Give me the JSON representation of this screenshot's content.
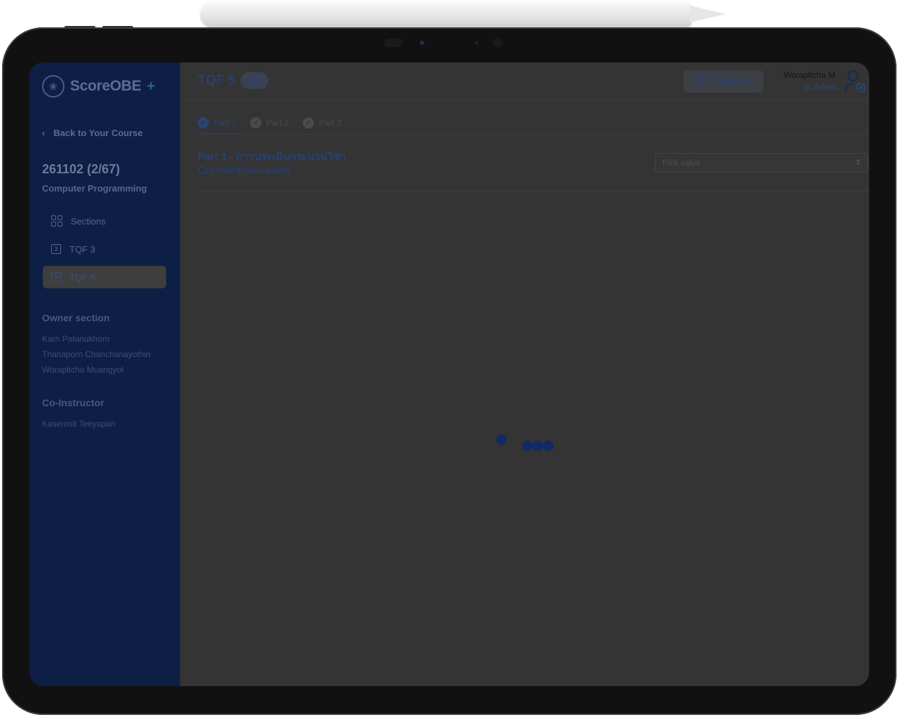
{
  "app": {
    "logo_text": "ScoreOBE",
    "logo_plus": "+"
  },
  "sidebar": {
    "back_label": "Back to Your Course",
    "course_code": "261102 (2/67)",
    "course_name": "Computer Programming",
    "nav": [
      {
        "label": "Sections",
        "icon": "grid-icon"
      },
      {
        "label": "TQF 3",
        "num": "3"
      },
      {
        "label": "TQF 5",
        "num": "5",
        "active": true
      }
    ],
    "owner_heading": "Owner section",
    "owners": [
      "Karn Patanukhom",
      "Thanaporn Chanchanayothin",
      "Worapitcha Muangyot"
    ],
    "coinstructor_heading": "Co-Instructor",
    "coinstructors": [
      "Kasemsit Teeyapan"
    ]
  },
  "header": {
    "title": "TQF 5",
    "badge": "INS",
    "feedback_label": "Feedback",
    "user_name": "Worapitcha M.",
    "user_role": "S. Admin"
  },
  "tabs": [
    {
      "label": "Part 1",
      "active": true
    },
    {
      "label": "Part 2",
      "active": false
    },
    {
      "label": "Part 3",
      "active": false
    }
  ],
  "part": {
    "title": "Part 1 - การประเมินกระบวนวิชา",
    "subtitle": "Course Evaluation",
    "picker_placeholder": "Pick value"
  },
  "colors": {
    "overlay": "#343434",
    "sidebar": "#0e1f45",
    "accent": "#0f2a66"
  }
}
